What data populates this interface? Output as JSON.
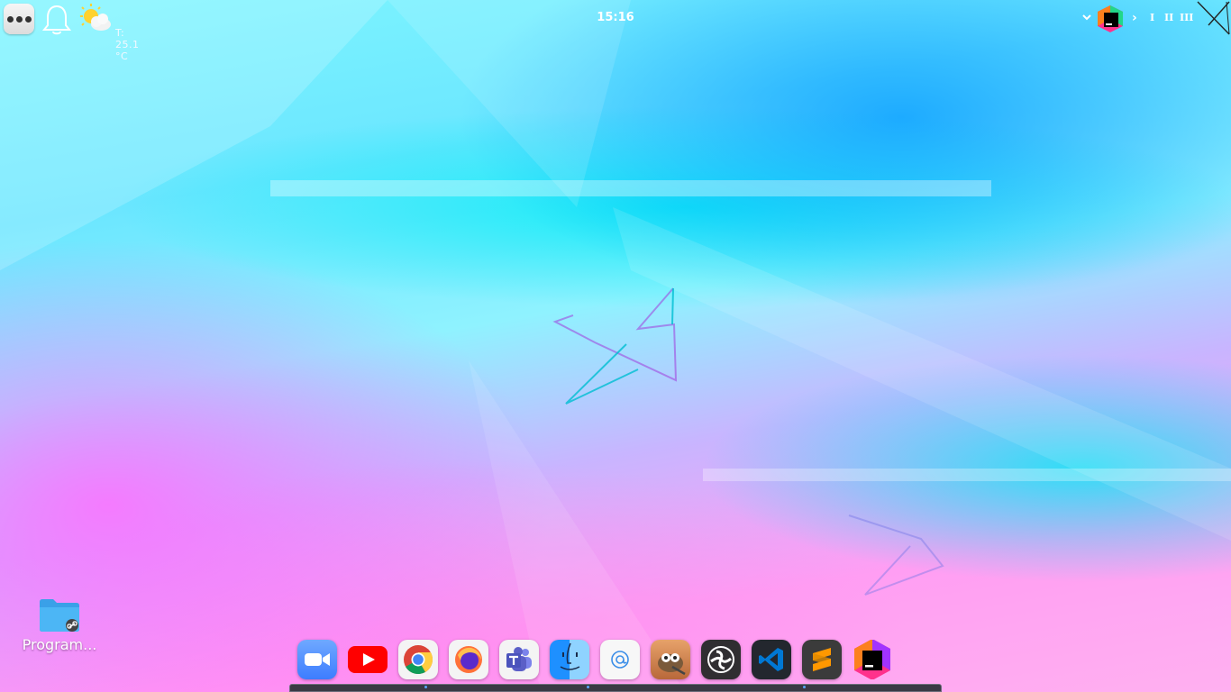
{
  "top_panel": {
    "clock": "15:16",
    "weather": {
      "temperature": "T: 25.1 °C",
      "icon": "partly-cloudy-icon"
    },
    "workspaces": [
      "I",
      "II",
      "III"
    ],
    "tray_arrow": "›"
  },
  "desktop_icons": [
    {
      "label": "Program...",
      "icon": "folder-link-icon"
    }
  ],
  "dock": {
    "apps": [
      {
        "name": "Zoom",
        "icon": "zoom-icon",
        "color": "#4a8cff"
      },
      {
        "name": "YouTube",
        "icon": "youtube-icon",
        "color": "#ff0000"
      },
      {
        "name": "Google Chrome",
        "icon": "chrome-icon",
        "color": "#ffffff"
      },
      {
        "name": "Firefox",
        "icon": "firefox-icon",
        "color": "#ff7139"
      },
      {
        "name": "Microsoft Teams",
        "icon": "teams-icon",
        "color": "#5b5fc7"
      },
      {
        "name": "Finder",
        "icon": "finder-icon",
        "color": "#1e90ff"
      },
      {
        "name": "Web Browser",
        "icon": "web-browser-icon",
        "color": "#3b8ee8"
      },
      {
        "name": "GIMP",
        "icon": "gimp-icon",
        "color": "#c77b3f"
      },
      {
        "name": "OBS Studio",
        "icon": "obs-icon",
        "color": "#302e31"
      },
      {
        "name": "Visual Studio Code",
        "icon": "vscode-icon",
        "color": "#0078d4"
      },
      {
        "name": "Sublime Text",
        "icon": "sublime-icon",
        "color": "#ff9800"
      },
      {
        "name": "JetBrains Toolbox",
        "icon": "jetbrains-icon",
        "color": "#ff318c"
      }
    ],
    "running_indicators": [
      2,
      5,
      9
    ]
  }
}
